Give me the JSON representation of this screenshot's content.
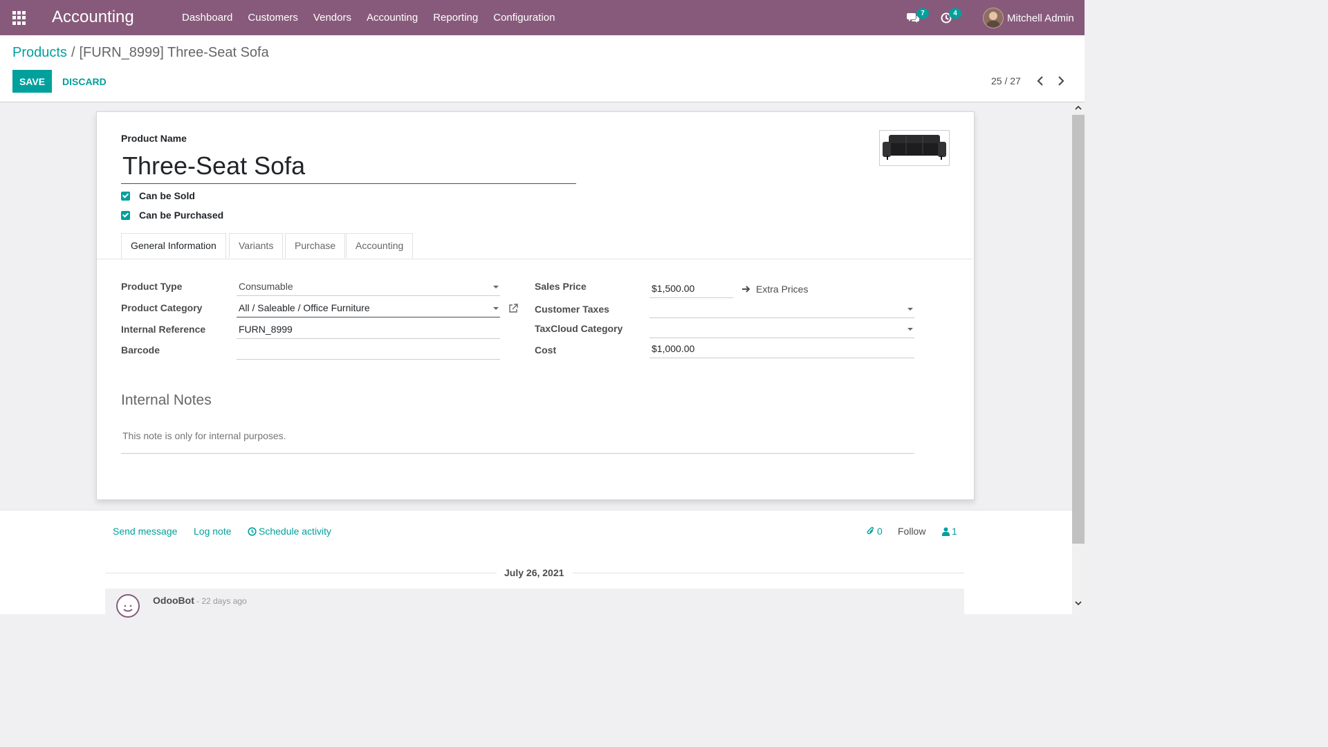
{
  "navbar": {
    "app_name": "Accounting",
    "menu": [
      "Dashboard",
      "Customers",
      "Vendors",
      "Accounting",
      "Reporting",
      "Configuration"
    ],
    "messages_badge": "7",
    "activities_badge": "4",
    "user_name": "Mitchell Admin"
  },
  "control_panel": {
    "breadcrumb_parent": "Products",
    "breadcrumb_separator": "/",
    "breadcrumb_current": "[FURN_8999] Three-Seat Sofa",
    "save_label": "SAVE",
    "discard_label": "DISCARD",
    "pager": "25 / 27"
  },
  "form": {
    "product_name_label": "Product Name",
    "product_name": "Three-Seat Sofa",
    "can_be_sold_label": "Can be Sold",
    "can_be_sold": true,
    "can_be_purchased_label": "Can be Purchased",
    "can_be_purchased": true,
    "tabs": [
      "General Information",
      "Variants",
      "Purchase",
      "Accounting"
    ],
    "active_tab": "General Information",
    "left_fields": {
      "product_type_label": "Product Type",
      "product_type": "Consumable",
      "product_category_label": "Product Category",
      "product_category": "All / Saleable / Office Furniture",
      "internal_reference_label": "Internal Reference",
      "internal_reference": "FURN_8999",
      "barcode_label": "Barcode",
      "barcode": ""
    },
    "right_fields": {
      "sales_price_label": "Sales Price",
      "sales_price": "$1,500.00",
      "extra_prices_label": "Extra Prices",
      "customer_taxes_label": "Customer Taxes",
      "customer_taxes": "",
      "taxcloud_category_label": "TaxCloud Category",
      "taxcloud_category": "",
      "cost_label": "Cost",
      "cost": "$1,000.00"
    },
    "internal_notes_title": "Internal Notes",
    "internal_notes_placeholder": "This note is only for internal purposes."
  },
  "chatter": {
    "send_message": "Send message",
    "log_note": "Log note",
    "schedule_activity": "Schedule activity",
    "attachments_count": "0",
    "follow_label": "Follow",
    "followers_count": "1",
    "date_separator": "July 26, 2021",
    "message_author": "OdooBot",
    "message_date": "- 22 days ago"
  },
  "colors": {
    "navbar": "#875a7b",
    "accent": "#00a09d"
  },
  "icons": [
    "apps-grid-icon",
    "chat-icon",
    "clock-icon",
    "chevron-left-icon",
    "chevron-right-icon",
    "external-link-icon",
    "arrow-right-icon",
    "paperclip-icon",
    "user-icon",
    "clock-circle-icon",
    "caret-down-icon"
  ]
}
